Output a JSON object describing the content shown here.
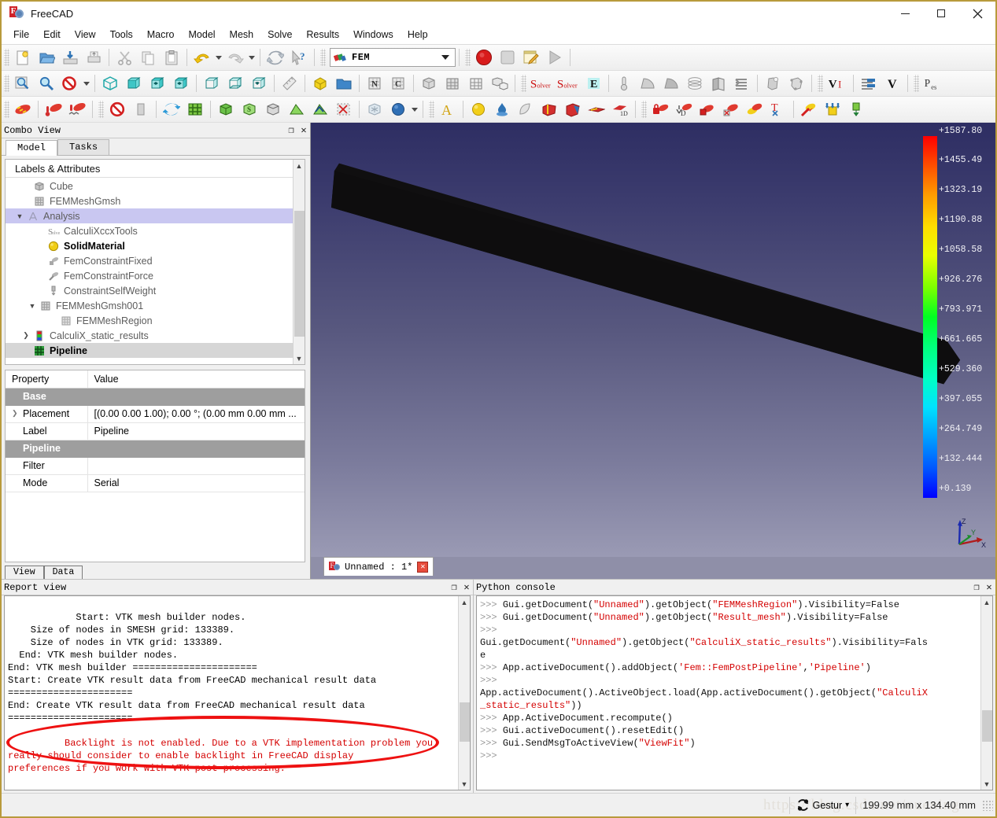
{
  "window": {
    "title": "FreeCAD",
    "buttons": {
      "minimize": "—",
      "maximize": "□",
      "close": "✕"
    }
  },
  "menubar": {
    "items": [
      "File",
      "Edit",
      "View",
      "Tools",
      "Macro",
      "Model",
      "Mesh",
      "Solve",
      "Results",
      "Windows",
      "Help"
    ]
  },
  "toolbar": {
    "workbench_selected": "FEM",
    "row1_icons": [
      "new-document-icon",
      "open-folder-icon",
      "save-icon",
      "print-icon",
      "cut-scissors-icon",
      "copy-icon",
      "paste-icon",
      "undo-icon",
      "redo-icon",
      "refresh-icon",
      "whats-this-icon"
    ],
    "row2_icons": [
      "fit-all-icon",
      "fit-selection-icon",
      "draw-style-icon",
      "isometric-view-icon",
      "front-view-icon",
      "top-view-icon",
      "right-view-icon",
      "rear-view-icon",
      "bottom-view-icon",
      "left-view-icon",
      "measure-icon",
      "part-box-icon",
      "folder-icon",
      "mesh-n-icon",
      "mesh-c-icon",
      "mesh-solid-icon",
      "mesh-grid-icon",
      "mesh-region-icon",
      "mesh-group-icon",
      "solver-ccx-icon",
      "solver-z88-icon",
      "solver-elmer-icon",
      "thermo-icon",
      "constraint-bearing-icon",
      "constraint-contact-icon",
      "constraint-layers-icon",
      "constraint-plane-icon",
      "constraint-section-icon",
      "constraint-transform-icon",
      "constraint-spring-icon",
      "result-show-icon",
      "result-filter-icon",
      "post-pipeline-icon",
      "post-clip-icon",
      "preferences-icon"
    ],
    "row3_icons": [
      "material-solid-icon",
      "material-thermal-icon",
      "material-nonlinear-icon",
      "element-none-icon",
      "element-geometry-icon",
      "mesh-refresh-icon",
      "mesh-grid-icon",
      "mesh-boundary-icon",
      "mesh-shell-icon",
      "mesh-region-icon",
      "mesh-face-icon",
      "mesh-net-icon",
      "mesh-group-icon",
      "mesh-clear-icon",
      "sphere-view-icon",
      "text-annotation-icon",
      "material-sphere-icon",
      "fluid-icon",
      "shell-icon",
      "solid-box-icon",
      "solid-section-icon",
      "beam-icon",
      "beam-1d-icon",
      "constraint-fixed-icon",
      "constraint-displacement-icon",
      "constraint-contact-icon",
      "constraint-tie-icon",
      "constraint-spring-icon",
      "constraint-transform-icon",
      "constraint-force-icon",
      "constraint-pressure-icon",
      "constraint-selfweight-icon"
    ]
  },
  "combo_view": {
    "title": "Combo View",
    "float_icon": "❐",
    "close_icon": "✕",
    "tabs": [
      {
        "label": "Model",
        "active": true
      },
      {
        "label": "Tasks",
        "active": false
      }
    ],
    "tree_header": "Labels & Attributes",
    "tree": [
      {
        "label": "Cube",
        "indent": 1,
        "icon": "cube-icon",
        "expander": "",
        "state": "normal"
      },
      {
        "label": "FEMMeshGmsh",
        "indent": 1,
        "icon": "mesh-icon",
        "expander": "",
        "state": "normal"
      },
      {
        "label": "Analysis",
        "indent": 0,
        "icon": "analysis-icon",
        "expander": "▼",
        "state": "selected"
      },
      {
        "label": "CalculiXccxTools",
        "indent": 2,
        "icon": "solver-icon",
        "expander": "",
        "state": "normal"
      },
      {
        "label": "SolidMaterial",
        "indent": 2,
        "icon": "material-sphere-icon",
        "expander": "",
        "state": "bold"
      },
      {
        "label": "FemConstraintFixed",
        "indent": 2,
        "icon": "constraint-fixed-icon",
        "expander": "",
        "state": "normal"
      },
      {
        "label": "FemConstraintForce",
        "indent": 2,
        "icon": "constraint-force-icon",
        "expander": "",
        "state": "normal"
      },
      {
        "label": "ConstraintSelfWeight",
        "indent": 2,
        "icon": "constraint-selfweight-icon",
        "expander": "",
        "state": "normal"
      },
      {
        "label": "FEMMeshGmsh001",
        "indent": 1,
        "icon": "mesh-icon",
        "expander": "▼",
        "state": "normal"
      },
      {
        "label": "FEMMeshRegion",
        "indent": 3,
        "icon": "mesh-region-icon",
        "expander": "",
        "state": "normal"
      },
      {
        "label": "CalculiX_static_results",
        "indent": 1,
        "icon": "results-icon",
        "expander": "❯",
        "state": "normal"
      },
      {
        "label": "Pipeline",
        "indent": 1,
        "icon": "pipeline-icon",
        "expander": "",
        "state": "selected-gray-bold"
      }
    ],
    "property_table": {
      "headers": [
        "Property",
        "Value"
      ],
      "rows": [
        {
          "kind": "group",
          "name": "Base"
        },
        {
          "kind": "prop",
          "name": "Placement",
          "value": "[(0.00 0.00 1.00); 0.00 °; (0.00 mm  0.00 mm ...",
          "twisty": "❯"
        },
        {
          "kind": "prop",
          "name": "Label",
          "value": "Pipeline",
          "twisty": ""
        },
        {
          "kind": "group",
          "name": "Pipeline"
        },
        {
          "kind": "prop",
          "name": "Filter",
          "value": "",
          "twisty": ""
        },
        {
          "kind": "prop",
          "name": "Mode",
          "value": "Serial",
          "twisty": ""
        }
      ]
    },
    "bottom_tabs": [
      {
        "label": "View"
      },
      {
        "label": "Data"
      }
    ]
  },
  "view3d": {
    "document_tab": {
      "label": "Unnamed : 1*",
      "close": "✕"
    },
    "legend_labels": [
      "+1587.80",
      "+1455.49",
      "+1323.19",
      "+1190.88",
      "+1058.58",
      "+926.276",
      "+793.971",
      "+661.665",
      "+529.360",
      "+397.055",
      "+264.749",
      "+132.444",
      "+0.139"
    ],
    "axis": {
      "x": "X",
      "y": "Y",
      "z": "Z"
    },
    "colors": {
      "legend_top": "#ff0000",
      "legend_bottom": "#0000ff",
      "background_top": "#2e2e63",
      "background_bottom": "#9a9ab4",
      "model": "#111111"
    }
  },
  "report_view": {
    "title": "Report view",
    "float_icon": "❐",
    "close_icon": "✕",
    "lines_black": "  Start: VTK mesh builder nodes.\n    Size of nodes in SMESH grid: 133389.\n    Size of nodes in VTK grid: 133389.\n  End: VTK mesh builder nodes.\nEnd: VTK mesh builder ======================\nStart: Create VTK result data from FreeCAD mechanical result data\n======================\nEnd: Create VTK result data from FreeCAD mechanical result data\n======================",
    "lines_red": "Backlight is not enabled. Due to a VTK implementation problem you\nreally should consider to enable backlight in FreeCAD display\npreferences if you work with VTK post processing.",
    "highlight_color": "#ee1111"
  },
  "python_console": {
    "title": "Python console",
    "float_icon": "❐",
    "close_icon": "✕",
    "lines": [
      {
        "prompt": ">>> ",
        "parts": [
          {
            "t": "Gui.getDocument(",
            "c": "k"
          },
          {
            "t": "\"Unnamed\"",
            "c": "s"
          },
          {
            "t": ").getObject(",
            "c": "k"
          },
          {
            "t": "\"FEMMeshRegion\"",
            "c": "s"
          },
          {
            "t": ").Visibility=False",
            "c": "k"
          }
        ]
      },
      {
        "prompt": ">>> ",
        "parts": [
          {
            "t": "Gui.getDocument(",
            "c": "k"
          },
          {
            "t": "\"Unnamed\"",
            "c": "s"
          },
          {
            "t": ").getObject(",
            "c": "k"
          },
          {
            "t": "\"Result_mesh\"",
            "c": "s"
          },
          {
            "t": ").Visibility=False",
            "c": "k"
          }
        ]
      },
      {
        "prompt": ">>> ",
        "parts": []
      },
      {
        "prompt": "",
        "parts": [
          {
            "t": "Gui.getDocument(",
            "c": "k"
          },
          {
            "t": "\"Unnamed\"",
            "c": "s"
          },
          {
            "t": ").getObject(",
            "c": "k"
          },
          {
            "t": "\"CalculiX_static_results\"",
            "c": "s"
          },
          {
            "t": ").Visibility=Fals",
            "c": "k"
          }
        ]
      },
      {
        "prompt": "",
        "parts": [
          {
            "t": "e",
            "c": "k"
          }
        ]
      },
      {
        "prompt": ">>> ",
        "parts": [
          {
            "t": "App.activeDocument().addObject(",
            "c": "k"
          },
          {
            "t": "'Fem::FemPostPipeline'",
            "c": "s"
          },
          {
            "t": ",",
            "c": "k"
          },
          {
            "t": "'Pipeline'",
            "c": "s"
          },
          {
            "t": ")",
            "c": "k"
          }
        ]
      },
      {
        "prompt": ">>> ",
        "parts": []
      },
      {
        "prompt": "",
        "parts": [
          {
            "t": "App.activeDocument().ActiveObject.load(App.activeDocument().getObject(",
            "c": "k"
          },
          {
            "t": "\"CalculiX",
            "c": "s"
          }
        ]
      },
      {
        "prompt": "",
        "parts": [
          {
            "t": "_static_results\"",
            "c": "s"
          },
          {
            "t": "))",
            "c": "k"
          }
        ]
      },
      {
        "prompt": ">>> ",
        "parts": [
          {
            "t": "App.ActiveDocument.recompute()",
            "c": "k"
          }
        ]
      },
      {
        "prompt": ">>> ",
        "parts": [
          {
            "t": "Gui.activeDocument().resetEdit()",
            "c": "k"
          }
        ]
      },
      {
        "prompt": ">>> ",
        "parts": [
          {
            "t": "Gui.SendMsgToActiveView(",
            "c": "k"
          },
          {
            "t": "\"ViewFit\"",
            "c": "s"
          },
          {
            "t": ")",
            "c": "k"
          }
        ]
      },
      {
        "prompt": ">>> ",
        "parts": []
      }
    ]
  },
  "statusbar": {
    "watermark": "https://blog.csdn.net/ouening",
    "navigation_mode": "Gestur",
    "navigation_caret": "▾",
    "dimensions": "199.99 mm x 134.40 mm"
  }
}
